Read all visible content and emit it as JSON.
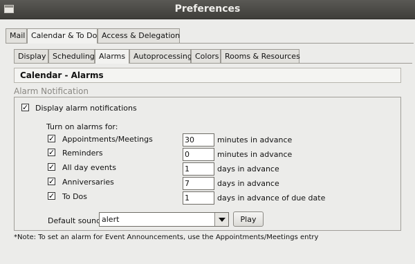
{
  "window": {
    "title": "Preferences"
  },
  "main_tabs": [
    {
      "label": "Mail"
    },
    {
      "label": "Calendar & To Do"
    },
    {
      "label": "Access & Delegation"
    }
  ],
  "sub_tabs": [
    {
      "label": "Display"
    },
    {
      "label": "Scheduling"
    },
    {
      "label": "Alarms"
    },
    {
      "label": "Autoprocessing"
    },
    {
      "label": "Colors"
    },
    {
      "label": "Rooms & Resources"
    }
  ],
  "section": {
    "title": "Calendar - Alarms"
  },
  "alarm_notification": {
    "group_label": "Alarm Notification",
    "display_label": "Display alarm notifications",
    "display_checked": true,
    "turn_on_label": "Turn on alarms for:",
    "rows": [
      {
        "label": "Appointments/Meetings",
        "checked": true,
        "value": "30",
        "suffix": "minutes in advance"
      },
      {
        "label": "Reminders",
        "checked": true,
        "value": "0",
        "suffix": "minutes in advance"
      },
      {
        "label": "All day events",
        "checked": true,
        "value": "1",
        "suffix": "days in advance"
      },
      {
        "label": "Anniversaries",
        "checked": true,
        "value": "7",
        "suffix": "days in advance"
      },
      {
        "label": "To Dos",
        "checked": true,
        "value": "1",
        "suffix": "days in advance of due date"
      }
    ],
    "sound_label": "Default sound",
    "sound_value": "alert",
    "play_label": "Play"
  },
  "note": "*Note: To set an alarm for Event Announcements, use the Appointments/Meetings entry",
  "colors": {
    "titlebar": "#3f3e3a",
    "window_bg": "#ececea"
  }
}
